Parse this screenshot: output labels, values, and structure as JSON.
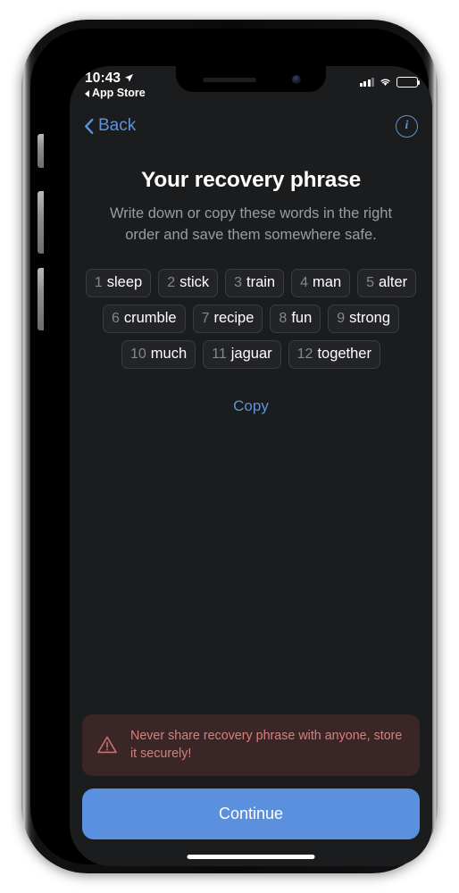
{
  "status_bar": {
    "time": "10:43",
    "location_icon": "location-arrow-icon",
    "return_label": "App Store",
    "signal_icon": "cellular-bars-icon",
    "wifi_icon": "wifi-icon",
    "battery_icon": "battery-full-icon"
  },
  "nav": {
    "back_label": "Back",
    "back_icon": "chevron-left-icon",
    "info_label": "i",
    "info_icon": "info-circle-icon"
  },
  "screen": {
    "title": "Your recovery phrase",
    "subtitle": "Write down or copy these words in the right order and save them somewhere safe.",
    "copy_label": "Copy",
    "continue_label": "Continue"
  },
  "recovery_phrase": {
    "words": [
      {
        "index": "1",
        "word": "sleep"
      },
      {
        "index": "2",
        "word": "stick"
      },
      {
        "index": "3",
        "word": "train"
      },
      {
        "index": "4",
        "word": "man"
      },
      {
        "index": "5",
        "word": "alter"
      },
      {
        "index": "6",
        "word": "crumble"
      },
      {
        "index": "7",
        "word": "recipe"
      },
      {
        "index": "8",
        "word": "fun"
      },
      {
        "index": "9",
        "word": "strong"
      },
      {
        "index": "10",
        "word": "much"
      },
      {
        "index": "11",
        "word": "jaguar"
      },
      {
        "index": "12",
        "word": "together"
      }
    ]
  },
  "warning": {
    "icon": "warning-triangle-icon",
    "text": "Never share recovery phrase with anyone, store it securely!"
  },
  "colors": {
    "screen_background": "#1b1c1e",
    "accent_blue": "#5d92d8",
    "button_blue": "#5a90dd",
    "warning_background": "#3a2626",
    "warning_text": "#d4817c",
    "chip_background": "#232428",
    "chip_border": "#3a3c42",
    "subtitle_grey": "#9a9ca2"
  }
}
